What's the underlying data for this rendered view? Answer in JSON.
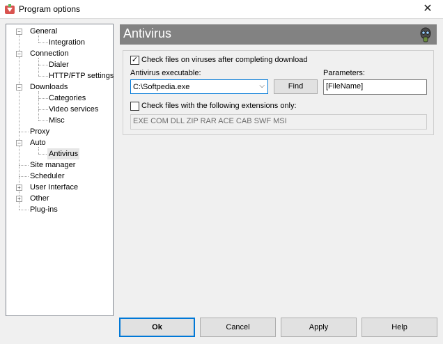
{
  "window": {
    "title": "Program options",
    "close_glyph": "✕"
  },
  "tree": {
    "items": [
      {
        "label": "General"
      },
      {
        "label": "Integration"
      },
      {
        "label": "Connection"
      },
      {
        "label": "Dialer"
      },
      {
        "label": "HTTP/FTP settings"
      },
      {
        "label": "Downloads"
      },
      {
        "label": "Categories"
      },
      {
        "label": "Video services"
      },
      {
        "label": "Misc"
      },
      {
        "label": "Proxy"
      },
      {
        "label": "Auto"
      },
      {
        "label": "Antivirus"
      },
      {
        "label": "Site manager"
      },
      {
        "label": "Scheduler"
      },
      {
        "label": "User Interface"
      },
      {
        "label": "Other"
      },
      {
        "label": "Plug-ins"
      }
    ]
  },
  "panel": {
    "title": "Antivirus",
    "check_on_download": {
      "label": "Check files on viruses after completing download",
      "checked": true
    },
    "executable_label": "Antivirus executable:",
    "executable_value": "C:\\Softpedia.exe",
    "find_label": "Find",
    "parameters_label": "Parameters:",
    "parameters_value": "[FileName]",
    "extensions_only": {
      "label": "Check files with the following extensions only:",
      "checked": false
    },
    "extensions_value": "EXE COM DLL ZIP RAR ACE CAB SWF MSI"
  },
  "buttons": {
    "ok": "Ok",
    "cancel": "Cancel",
    "apply": "Apply",
    "help": "Help"
  },
  "glyphs": {
    "check": "✓",
    "plus": "+",
    "minus": "−",
    "dropdown": "⌵"
  }
}
